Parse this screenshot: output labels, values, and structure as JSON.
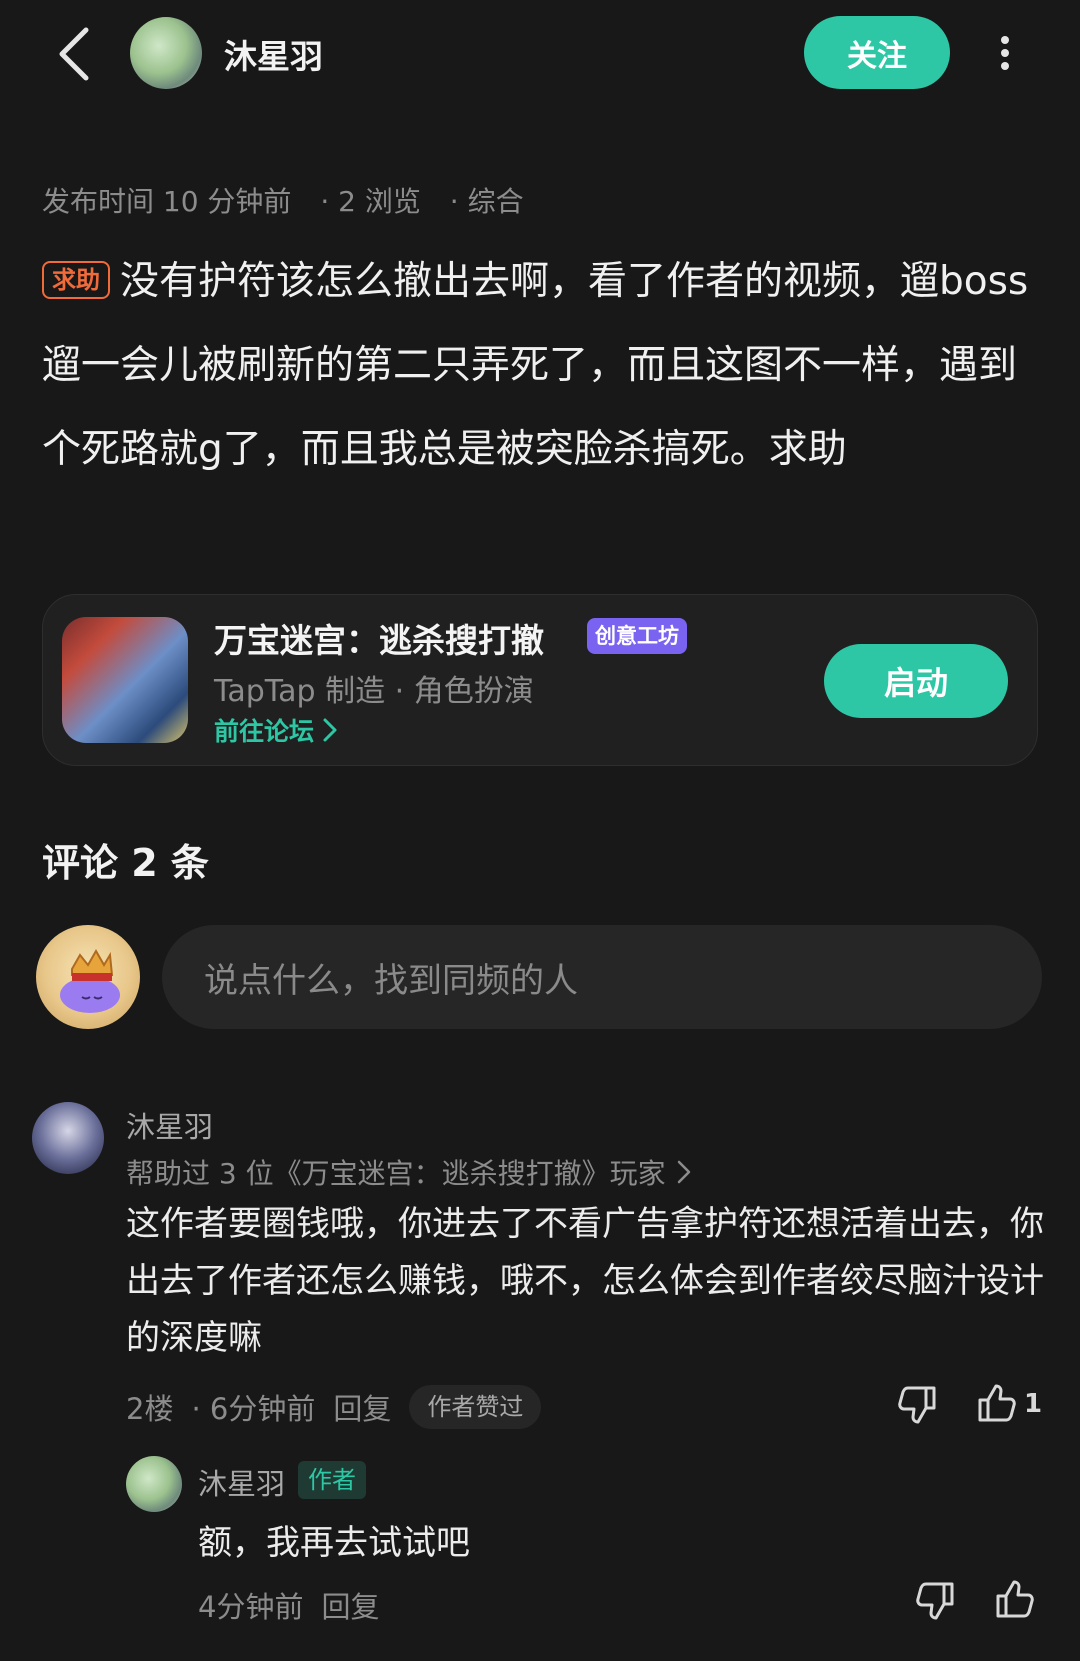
{
  "header": {
    "author_name": "沐星羽",
    "follow_label": "关注",
    "icons": {
      "back": "chevron-left-icon",
      "more": "more-vertical-icon"
    }
  },
  "post": {
    "publish_label": "发布时间 10 分钟前",
    "views": "· 2 浏览",
    "category": "· 综合",
    "tag": "求助",
    "content": "没有护符该怎么撤出去啊，看了作者的视频，遛boss遛一会儿被刷新的第二只弄死了，而且这图不一样，遇到个死路就g了，而且我总是被突脸杀搞死。求助"
  },
  "game_card": {
    "title": "万宝迷宫：逃杀搜打撤",
    "badge": "创意工坊",
    "subtitle": "TapTap 制造 · 角色扮演",
    "forum_link": "前往论坛",
    "launch_label": "启动"
  },
  "comments": {
    "title": "评论 2 条",
    "input_placeholder": "说点什么，找到同频的人",
    "items": [
      {
        "name": "沐星羽",
        "helped": "帮助过 3 位《万宝迷宫：逃杀搜打撤》玩家",
        "text": "这作者要圈钱哦，你进去了不看广告拿护符还想活着出去，你出去了作者还怎么赚钱，哦不，怎么体会到作者绞尽脑汁设计的深度嘛",
        "floor": "2楼",
        "time": "· 6分钟前",
        "reply_label": "回复",
        "liked_badge": "作者赞过",
        "like_count": "1",
        "reply": {
          "name": "沐星羽",
          "author_badge": "作者",
          "text": "额，我再去试试吧",
          "time": "4分钟前",
          "reply_label": "回复"
        }
      }
    ]
  },
  "colors": {
    "background": "#181818",
    "accent": "#2ec7a5",
    "tag_orange": "#f06a3a",
    "badge_purple": "#7a63f0"
  }
}
